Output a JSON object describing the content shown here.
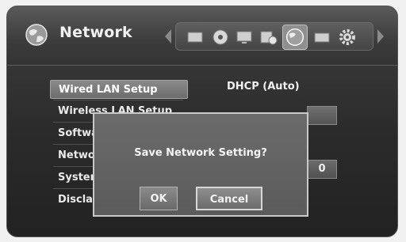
{
  "header": {
    "title": "Network",
    "category_icons": [
      {
        "name": "tv-icon"
      },
      {
        "name": "disc-icon"
      },
      {
        "name": "monitor-icon"
      },
      {
        "name": "audio-settings-icon"
      },
      {
        "name": "network-globe-icon",
        "selected": true
      },
      {
        "name": "card-icon"
      },
      {
        "name": "gear-icon"
      }
    ]
  },
  "menu": {
    "items": [
      {
        "label": "Wired LAN Setup",
        "selected": true
      },
      {
        "label": "Wireless LAN Setup"
      },
      {
        "label": "Software Update"
      },
      {
        "label": "Network Settings"
      },
      {
        "label": "System Info"
      },
      {
        "label": "Disclaimer Notice"
      }
    ]
  },
  "details": {
    "mode": "DHCP (Auto)",
    "ip_last_octet": "0"
  },
  "dialog": {
    "message": "Save Network Setting?",
    "ok_label": "OK",
    "cancel_label": "Cancel",
    "focused": "Cancel"
  },
  "colors": {
    "background": "#2b2b2b",
    "header": "#474747",
    "dialog": "#636363",
    "text": "#f0f0f0"
  }
}
